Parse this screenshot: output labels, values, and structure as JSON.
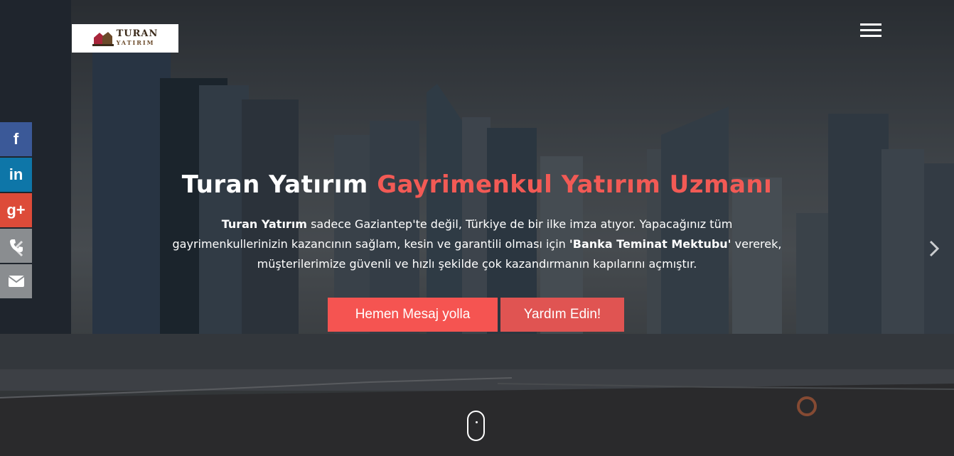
{
  "logo": {
    "text": "TURAN",
    "subtext": "YATIRIM"
  },
  "social": [
    {
      "label": "f",
      "name": "facebook-icon",
      "color": "#3b5998"
    },
    {
      "label": "in",
      "name": "linkedin-icon",
      "color": "#0e76a8"
    },
    {
      "label": "g+",
      "name": "google-plus-icon",
      "color": "#dd4b39"
    },
    {
      "label": "",
      "name": "phone-icon",
      "color": "#8a8d90"
    },
    {
      "label": "",
      "name": "mail-icon",
      "color": "#8a8d90"
    }
  ],
  "hero": {
    "title_white": "Turan Yatırım",
    "title_accent": "Gayrimenkul Yatırım Uzmanı",
    "desc_brand": "Turan Yatırım",
    "desc_part1": " sadece Gaziantep'te değil, Türkiye de bir ilke imza atıyor. Yapacağınız tüm gayrimenkullerinizin kazancının sağlam, kesin ve garantili olması için ",
    "desc_highlight": "'Banka Teminat Mektubu'",
    "desc_part2": " vererek, müşterilerimize güvenli ve hızlı şekilde çok kazandırmanın kapılarını açmıştır.",
    "btn_primary": "Hemen Mesaj yolla",
    "btn_secondary": "Yardım Edin!"
  },
  "colors": {
    "accent": "#f25a55",
    "button_primary": "#f55451",
    "button_secondary": "#e05452"
  }
}
